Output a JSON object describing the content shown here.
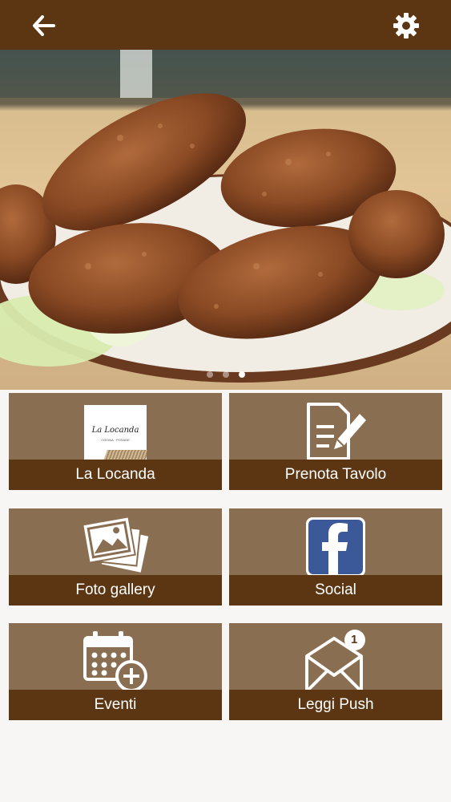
{
  "app": {
    "back_icon": "arrow-left-icon",
    "settings_icon": "gear-icon",
    "bar_color": "#5c3613",
    "tile_color": "#8a6e52"
  },
  "hero": {
    "subject": "fried meat croquettes on a plate with lettuce",
    "slides_total": 3,
    "active_slide": 3
  },
  "logo": {
    "name": "La Locanda",
    "subtitle": "COCINA · POSADE"
  },
  "tiles": [
    {
      "label": "La Locanda",
      "icon": "logo-image"
    },
    {
      "label": "Prenota Tavolo",
      "icon": "document-pen-icon"
    },
    {
      "label": "Foto gallery",
      "icon": "photo-stack-icon"
    },
    {
      "label": "Social",
      "icon": "facebook-icon"
    },
    {
      "label": "Eventi",
      "icon": "calendar-plus-icon"
    },
    {
      "label": "Leggi Push",
      "icon": "envelope-badge-icon"
    }
  ],
  "push": {
    "unread_count": "1"
  }
}
